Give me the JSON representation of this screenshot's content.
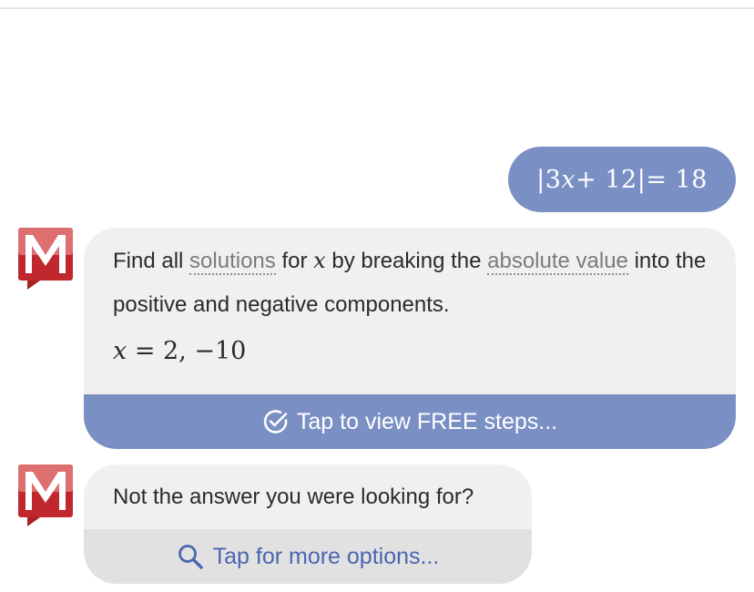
{
  "query": {
    "lhs_open": "|3",
    "var": "x",
    "lhs_rest": " + 12|",
    "rhs": " = 18"
  },
  "answer": {
    "text_1": "Find all ",
    "link_solutions": "solutions",
    "text_2": " for ",
    "var": "x",
    "text_3": " by breaking the ",
    "link_absolute_value": "absolute value",
    "text_4": " into the positive and negative components.",
    "result_var": "x",
    "result_rest": " = 2, −10"
  },
  "steps_button": {
    "label": "Tap to view FREE steps...",
    "icon": "check-circle-icon"
  },
  "options": {
    "question": "Not the answer you were looking for?",
    "button_label": "Tap for more options...",
    "icon": "search-icon"
  },
  "avatar": {
    "icon": "mathway-logo-icon",
    "letter": "M"
  },
  "colors": {
    "accent_blue": "#7a8fc4",
    "link_blue": "#4b66b0",
    "logo_red": "#b8262b",
    "card_gray": "#f0f0f0",
    "button_gray": "#e1e1e1"
  }
}
